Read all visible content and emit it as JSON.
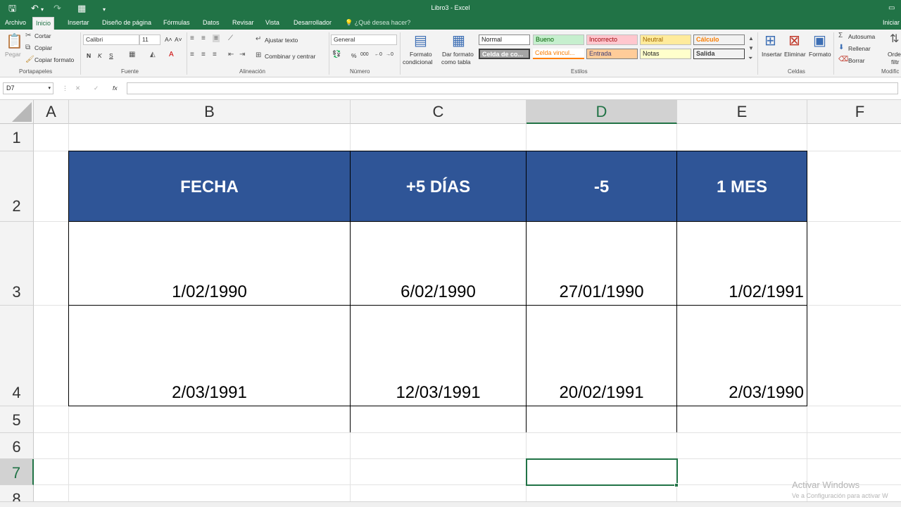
{
  "window": {
    "title": "Libro3 - Excel",
    "signin": "Iniciar"
  },
  "tabs": [
    {
      "label": "Archivo"
    },
    {
      "label": "Inicio"
    },
    {
      "label": "Insertar"
    },
    {
      "label": "Diseño de página"
    },
    {
      "label": "Fórmulas"
    },
    {
      "label": "Datos"
    },
    {
      "label": "Revisar"
    },
    {
      "label": "Vista"
    },
    {
      "label": "Desarrollador"
    }
  ],
  "tell_me": "¿Qué desea hacer?",
  "ribbon": {
    "clipboard": {
      "paste": "Pegar",
      "cut": "Cortar",
      "copy": "Copiar",
      "format_painter": "Copiar formato",
      "label": "Portapapeles"
    },
    "font": {
      "name": "Calibri",
      "size": "11",
      "bold": "N",
      "italic": "K",
      "underline": "S",
      "label": "Fuente"
    },
    "alignment": {
      "wrap": "Ajustar texto",
      "merge": "Combinar y centrar",
      "label": "Alineación"
    },
    "number": {
      "format": "General",
      "percent": "%",
      "thousands": "000",
      "label": "Número"
    },
    "styles": {
      "conditional_1": "Formato",
      "conditional_2": "condicional",
      "table_1": "Dar formato",
      "table_2": "como tabla",
      "cells": [
        "Normal",
        "Bueno",
        "Incorrecto",
        "Neutral",
        "Cálculo",
        "Celda de co...",
        "Celda vincul...",
        "Entrada",
        "Notas",
        "Salida"
      ],
      "label": "Estilos"
    },
    "cells_group": {
      "insert": "Insertar",
      "delete": "Eliminar",
      "format": "Formato",
      "label": "Celdas"
    },
    "editing": {
      "autosum": "Autosuma",
      "fill": "Rellenar",
      "clear": "Borrar",
      "sort_1": "Orde",
      "sort_2": "filtr",
      "label": "Modific"
    }
  },
  "formula_bar": {
    "name_box": "D7",
    "cancel": "✕",
    "enter": "✓",
    "fx": "fx",
    "value": ""
  },
  "columns": [
    "A",
    "B",
    "C",
    "D",
    "E",
    "F"
  ],
  "rows": [
    "1",
    "2",
    "3",
    "4",
    "5",
    "6",
    "7",
    "8"
  ],
  "selected_cell": "D7",
  "table": {
    "headers": [
      "FECHA",
      "+5 DÍAS",
      "-5",
      "1 MES"
    ],
    "rows": [
      [
        "1/02/1990",
        "6/02/1990",
        "27/01/1990",
        "1/02/1991"
      ],
      [
        "2/03/1991",
        "12/03/1991",
        "20/02/1991",
        "2/03/1990"
      ]
    ]
  },
  "watermark": {
    "title": "Activar Windows",
    "subtitle": "Ve a Configuración para activar W"
  },
  "colors": {
    "excel_green": "#217346",
    "header_fill": "#2f5597",
    "header_text": "#ffffff"
  }
}
